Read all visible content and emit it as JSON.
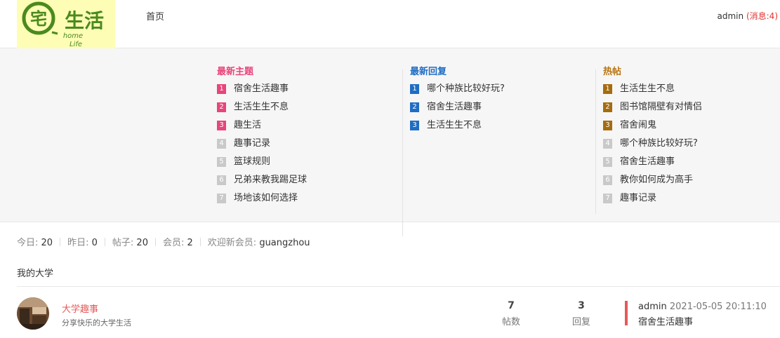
{
  "header": {
    "logo_text": "宅生活",
    "logo_sub": "home life",
    "nav_home": "首页",
    "user": "admin",
    "messages": "(消息:4)"
  },
  "panel": {
    "latest_topics": {
      "title": "最新主题",
      "items": [
        "宿舍生活趣事",
        "生活生生不息",
        "趣生活",
        "趣事记录",
        "篮球规则",
        "兄弟来教我踢足球",
        "场地该如何选择"
      ]
    },
    "latest_replies": {
      "title": "最新回复",
      "items": [
        "哪个种族比较好玩?",
        "宿舍生活趣事",
        "生活生生不息"
      ]
    },
    "hot_posts": {
      "title": "热帖",
      "items": [
        "生活生生不息",
        "图书馆隔壁有对情侣",
        "宿舍闹鬼",
        "哪个种族比较好玩?",
        "宿舍生活趣事",
        "教你如何成为高手",
        "趣事记录"
      ]
    }
  },
  "stats": {
    "today_label": "今日:",
    "today": "20",
    "yesterday_label": "昨日:",
    "yesterday": "0",
    "posts_label": "帖子:",
    "posts": "20",
    "members_label": "会员:",
    "members": "2",
    "welcome_label": "欢迎新会员:",
    "newest_member": "guangzhou"
  },
  "section": {
    "title": "我的大学"
  },
  "forum": {
    "name": "大学趣事",
    "description": "分享快乐的大学生活",
    "threads": "7",
    "threads_label": "帖数",
    "replies": "3",
    "replies_label": "回复",
    "last_user": "admin",
    "last_time": "2021-05-05 20:11:10",
    "last_title": "宿舍生活趣事"
  },
  "colors": {
    "topics_accent": "#e8457a",
    "replies_accent": "#1f6dc4",
    "hot_accent": "#b87410",
    "forum_accent": "#e55a5a",
    "logo_green": "#4a8a1e",
    "logo_bg": "#fdfdb6"
  }
}
